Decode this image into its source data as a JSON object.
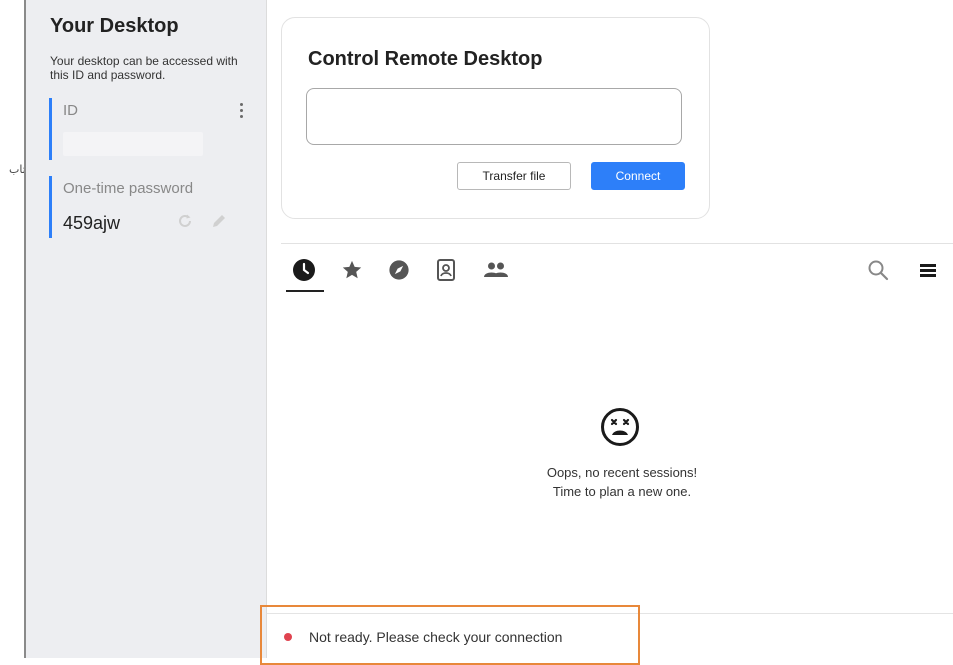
{
  "left_fragment": "اتاب",
  "sidebar": {
    "title": "Your Desktop",
    "description": "Your desktop can be accessed with this ID and password.",
    "id_label": "ID",
    "password_label": "One-time password",
    "password_value": "459ajw"
  },
  "remote": {
    "title": "Control Remote Desktop",
    "input_value": "",
    "transfer_label": "Transfer file",
    "connect_label": "Connect"
  },
  "tabs": [
    {
      "name": "recent-sessions",
      "icon": "clock-icon",
      "active": true
    },
    {
      "name": "favorites",
      "icon": "star-icon",
      "active": false
    },
    {
      "name": "discovered",
      "icon": "compass-icon",
      "active": false
    },
    {
      "name": "address-book",
      "icon": "contact-book-icon",
      "active": false
    },
    {
      "name": "group",
      "icon": "people-icon",
      "active": false
    }
  ],
  "empty_state": {
    "line1": "Oops, no recent sessions!",
    "line2": "Time to plan a new one."
  },
  "status": {
    "text": "Not ready. Please check your connection",
    "color": "#e0434f"
  },
  "colors": {
    "accent": "#2d7ff9",
    "highlight_border": "#e8883a"
  }
}
